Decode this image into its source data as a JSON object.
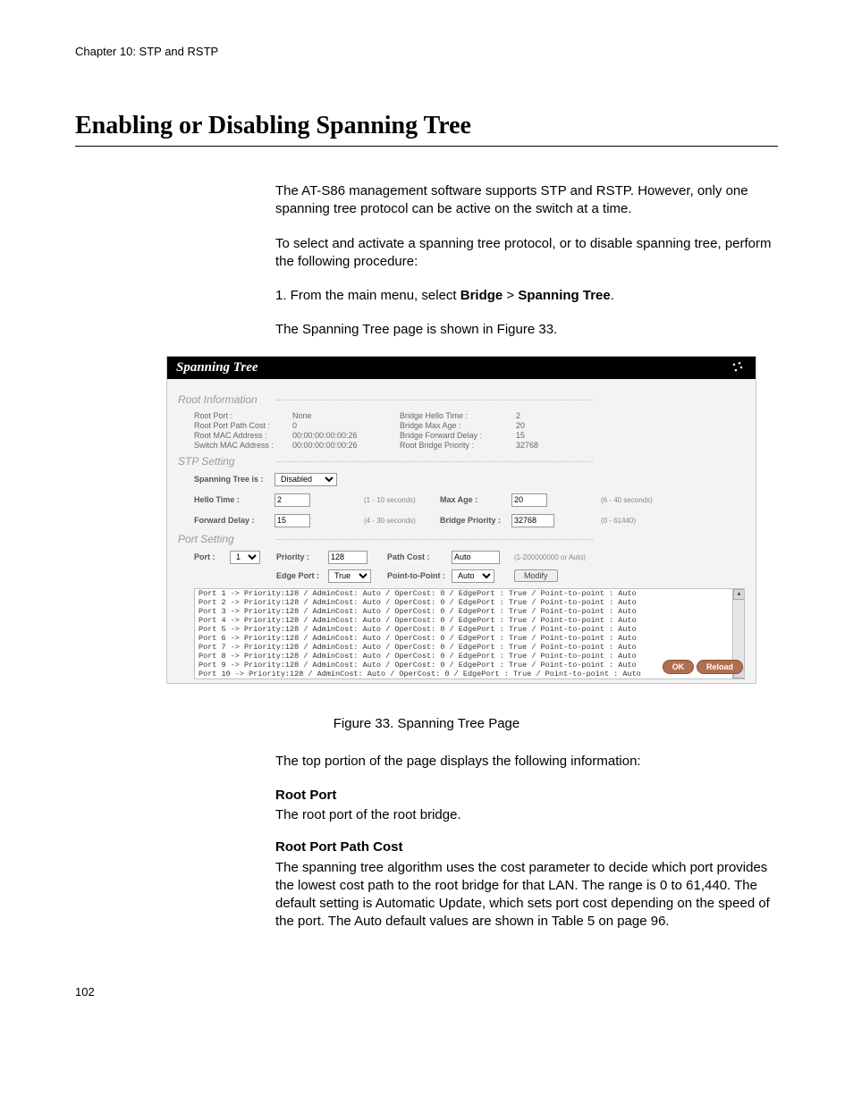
{
  "header": {
    "chapter": "Chapter 10: STP and RSTP"
  },
  "title": "Enabling or Disabling Spanning Tree",
  "para1": "The AT-S86 management software supports STP and RSTP. However, only one spanning tree protocol can be active on the switch at a time.",
  "para2": "To select and activate a spanning tree protocol, or to disable spanning tree, perform the following procedure:",
  "step1_prefix": "1.  From the main menu, select ",
  "step1_bridge": "Bridge",
  "step1_sep": " > ",
  "step1_spanning": "Spanning Tree",
  "step1_suffix": ".",
  "step1_result": "The Spanning Tree page is shown in Figure 33.",
  "shot": {
    "title": "Spanning Tree",
    "sect_root": "Root Information",
    "root": {
      "l1a": "Root Port :",
      "l1b": "None",
      "l2a": "Root Port Path Cost :",
      "l2b": "0",
      "l3a": "Root MAC Address :",
      "l3b": "00:00:00:00:00:26",
      "l4a": "Switch MAC Address :",
      "l4b": "00:00:00:00:00:26",
      "r1a": "Bridge Hello Time :",
      "r1b": "2",
      "r2a": "Bridge Max Age :",
      "r2b": "20",
      "r3a": "Bridge Forward Delay :",
      "r3b": "15",
      "r4a": "Root Bridge Priority :",
      "r4b": "32768"
    },
    "sect_stp": "STP Setting",
    "stp": {
      "spanning_lbl": "Spanning Tree is :",
      "spanning_val": "Disabled",
      "hello_lbl": "Hello Time :",
      "hello_val": "2",
      "hello_hint": "(1 - 10 seconds)",
      "fwd_lbl": "Forward Delay :",
      "fwd_val": "15",
      "fwd_hint": "(4 - 30 seconds)",
      "maxage_lbl": "Max Age :",
      "maxage_val": "20",
      "maxage_hint": "(6 - 40 seconds)",
      "prio_lbl": "Bridge Priority :",
      "prio_val": "32768",
      "prio_hint": "(0 - 61440)"
    },
    "sect_port": "Port Setting",
    "port": {
      "port_lbl": "Port :",
      "port_val": "1",
      "prio_lbl": "Priority :",
      "prio_val": "128",
      "pcost_lbl": "Path Cost :",
      "pcost_val": "Auto",
      "pcost_hint": "(1-200000000 or Auto)",
      "edge_lbl": "Edge Port :",
      "edge_val": "True",
      "p2p_lbl": "Point-to-Point :",
      "p2p_val": "Auto",
      "modify": "Modify"
    },
    "rows": [
      "Port 1  -> Priority:128 / AdminCost:       Auto / OperCost:            0 / EdgePort : True  / Point-to-point : Auto",
      "Port 2  -> Priority:128 / AdminCost:       Auto / OperCost:            0 / EdgePort : True  / Point-to-point : Auto",
      "Port 3  -> Priority:128 / AdminCost:       Auto / OperCost:            0 / EdgePort : True  / Point-to-point : Auto",
      "Port 4  -> Priority:128 / AdminCost:       Auto / OperCost:            0 / EdgePort : True  / Point-to-point : Auto",
      "Port 5  -> Priority:128 / AdminCost:       Auto / OperCost:            0 / EdgePort : True  / Point-to-point : Auto",
      "Port 6  -> Priority:128 / AdminCost:       Auto / OperCost:            0 / EdgePort : True  / Point-to-point : Auto",
      "Port 7  -> Priority:128 / AdminCost:       Auto / OperCost:            0 / EdgePort : True  / Point-to-point : Auto",
      "Port 8  -> Priority:128 / AdminCost:       Auto / OperCost:            0 / EdgePort : True  / Point-to-point : Auto",
      "Port 9  -> Priority:128 / AdminCost:       Auto / OperCost:            0 / EdgePort : True  / Point-to-point : Auto",
      "Port 10 -> Priority:128 / AdminCost:       Auto / OperCost:            0 / EdgePort : True  / Point-to-point : Auto"
    ],
    "ok": "OK",
    "reload": "Reload"
  },
  "fig_caption": "Figure 33. Spanning Tree Page",
  "para3": "The top portion of the page displays the following information:",
  "def1_term": "Root Port",
  "def1_desc": "The root port of the root bridge.",
  "def2_term": "Root Port Path Cost",
  "def2_desc": "The spanning tree algorithm uses the cost parameter to decide which port provides the lowest cost path to the root bridge for that LAN. The range is 0 to 61,440. The default setting is Automatic Update, which sets port cost depending on the speed of the port. The Auto default values are shown in Table 5 on page 96.",
  "page_number": "102"
}
